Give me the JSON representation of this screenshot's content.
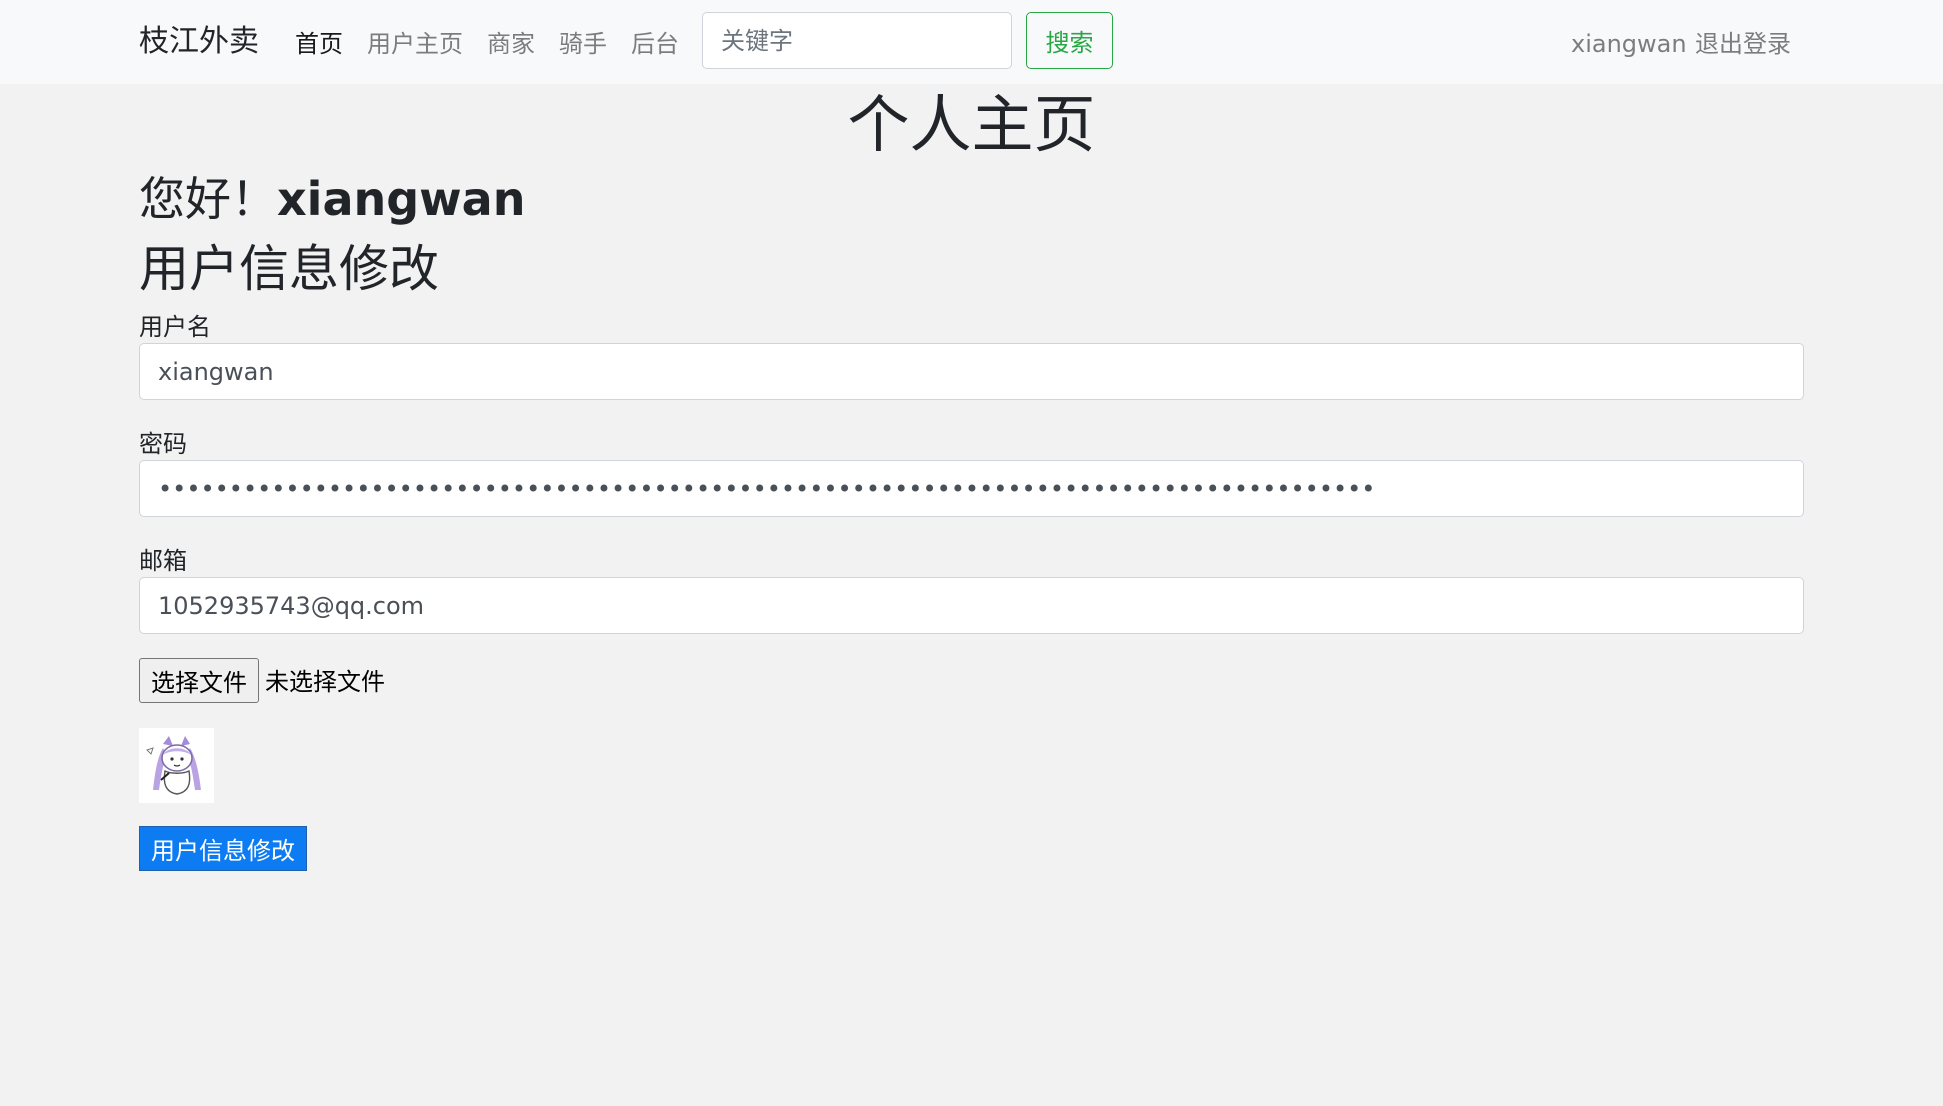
{
  "navbar": {
    "brand": "枝江外卖",
    "links": [
      {
        "label": "首页",
        "active": true
      },
      {
        "label": "用户主页",
        "active": false
      },
      {
        "label": "商家",
        "active": false
      },
      {
        "label": "骑手",
        "active": false
      },
      {
        "label": "后台",
        "active": false
      }
    ],
    "search": {
      "placeholder": "关键字",
      "value": "",
      "button_label": "搜索"
    },
    "username": "xiangwan",
    "logout_label": "退出登录"
  },
  "page": {
    "title": "个人主页",
    "greeting_prefix": "您好！",
    "greeting_name": "xiangwan",
    "section_title": "用户信息修改"
  },
  "form": {
    "username_label": "用户名",
    "username_value": "xiangwan",
    "password_label": "密码",
    "password_value": "••••••••••••••••••••••••••••••••••••••••••••••••••••••••••••••••••••••••••••••••••••••",
    "email_label": "邮箱",
    "email_value": "1052935743@qq.com",
    "file_button_label": "选择文件",
    "file_status": "未选择文件",
    "submit_label": "用户信息修改"
  },
  "colors": {
    "accent": "#0d7cf2",
    "search_green": "#28a745",
    "background": "#f2f2f2",
    "navbar_bg": "#f8f9fa"
  }
}
